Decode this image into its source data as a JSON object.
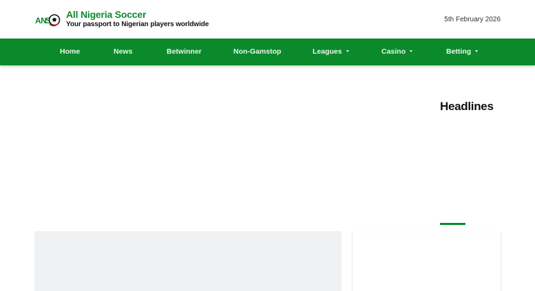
{
  "brand": {
    "logo_text": "ANS",
    "title": "All Nigeria Soccer",
    "tagline": "Your passport to Nigerian players worldwide",
    "logo_icon": "soccer-ball-icon"
  },
  "header": {
    "date": "5th February 2026"
  },
  "nav": {
    "items": [
      {
        "label": "Home",
        "dropdown": false
      },
      {
        "label": "News",
        "dropdown": false
      },
      {
        "label": "Betwinner",
        "dropdown": false
      },
      {
        "label": "Non-Gamstop",
        "dropdown": false
      },
      {
        "label": "Leagues",
        "dropdown": true
      },
      {
        "label": "Casino",
        "dropdown": true
      },
      {
        "label": "Betting",
        "dropdown": true
      }
    ]
  },
  "sidebar": {
    "heading": "Headlines"
  },
  "colors": {
    "brand_green": "#0b8a2c",
    "nav_text": "#eaf6ea",
    "card_gray": "#f0f1f3"
  }
}
